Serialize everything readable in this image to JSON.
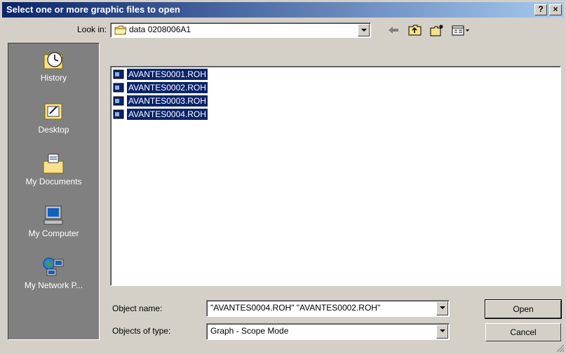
{
  "window": {
    "title": "Select one or more graphic files to open",
    "help_button": "?",
    "close_button": "×"
  },
  "lookin": {
    "label": "Look in:",
    "value": "data 0208006A1",
    "icons": [
      "back-arrow-icon",
      "up-folder-icon",
      "new-folder-icon",
      "view-menu-icon"
    ]
  },
  "places": [
    {
      "label": "History",
      "icon": "history-icon"
    },
    {
      "label": "Desktop",
      "icon": "desktop-icon"
    },
    {
      "label": "My Documents",
      "icon": "my-documents-icon"
    },
    {
      "label": "My Computer",
      "icon": "my-computer-icon"
    },
    {
      "label": "My Network P...",
      "icon": "my-network-places-icon"
    }
  ],
  "files": [
    {
      "name": "AVANTES0001.ROH",
      "selected": true
    },
    {
      "name": "AVANTES0002.ROH",
      "selected": true
    },
    {
      "name": "AVANTES0003.ROH",
      "selected": true
    },
    {
      "name": "AVANTES0004.ROH",
      "selected": true
    }
  ],
  "object_name": {
    "label": "Object name:",
    "value": "\"AVANTES0004.ROH\" \"AVANTES0002.ROH\""
  },
  "object_type": {
    "label": "Objects of type:",
    "value": "Graph - Scope Mode"
  },
  "buttons": {
    "open": "Open",
    "cancel": "Cancel"
  }
}
